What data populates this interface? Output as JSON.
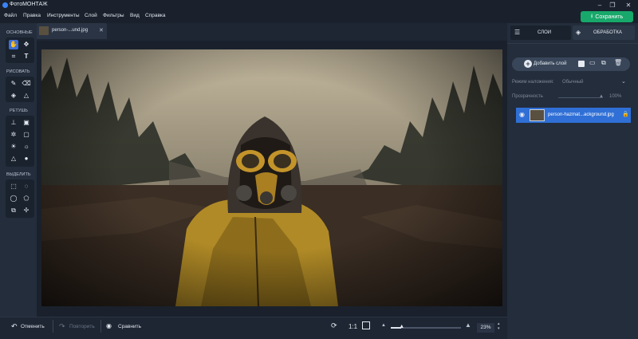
{
  "window": {
    "title": "ФотоМОНТАЖ",
    "minimize": "–",
    "maximize": "❐",
    "close": "✕"
  },
  "menu": [
    "Файл",
    "Правка",
    "Инструменты",
    "Слой",
    "Фильтры",
    "Вид",
    "Справка"
  ],
  "save_button": {
    "label": "Сохранить",
    "color": "#18a86b"
  },
  "toolbar": {
    "sections": [
      "ОСНОВНЫЕ",
      "РИСОВАТЬ",
      "РЕТУШЬ",
      "ВЫДЕЛИТЬ"
    ]
  },
  "document_tab": {
    "label": "person-...und.jpg",
    "close": "✕"
  },
  "bottom": {
    "undo": "Отменить",
    "redo": "Повторить",
    "compare": "Сравнить",
    "ratio": "1:1",
    "zoom": "23%",
    "zoom_level": 0.15
  },
  "right_panel": {
    "tabs": [
      "СЛОИ",
      "ОБРАБОТКА"
    ],
    "add_layer": "Добавить слой",
    "blend_label": "Режим наложения:",
    "blend_value": "Обычный",
    "opacity_label": "Прозрачность",
    "opacity_value": "100%",
    "layer_name": "person-hazmat...ackground.jpg"
  },
  "colors": {
    "accent": "#2f6fd6",
    "save": "#18a86b"
  }
}
